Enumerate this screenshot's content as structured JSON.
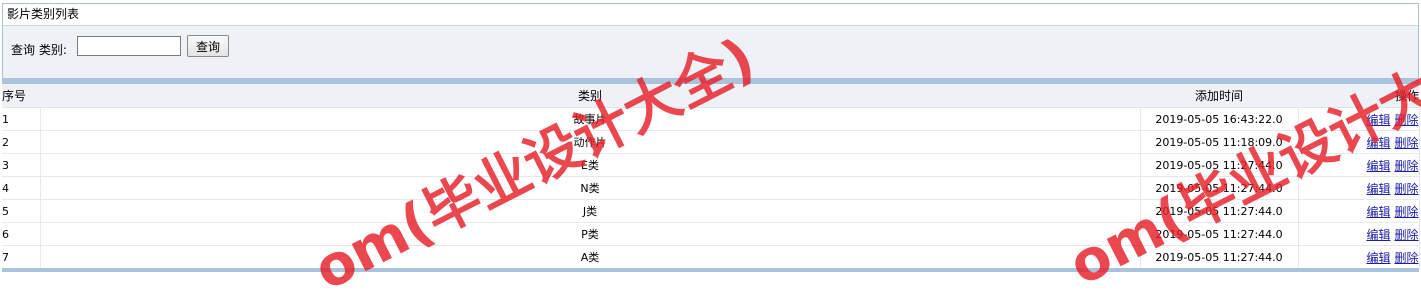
{
  "page": {
    "title": "影片类别列表"
  },
  "search": {
    "label": "查询 类别:",
    "value": "",
    "placeholder": "",
    "button_label": "查询"
  },
  "table": {
    "headers": {
      "seq": "序号",
      "type": "类别",
      "time": "添加时间",
      "ops": "操作"
    },
    "edit_label": "编辑",
    "delete_label": "删除",
    "rows": [
      {
        "seq": "1",
        "type": "故事片",
        "time": "2019-05-05 16:43:22.0"
      },
      {
        "seq": "2",
        "type": "动作片",
        "time": "2019-05-05 11:18:09.0"
      },
      {
        "seq": "3",
        "type": "E类",
        "time": "2019-05-05 11:27:44.0"
      },
      {
        "seq": "4",
        "type": "N类",
        "time": "2019-05-05 11:27:44.0"
      },
      {
        "seq": "5",
        "type": "J类",
        "time": "2019-05-05 11:27:44.0"
      },
      {
        "seq": "6",
        "type": "P类",
        "time": "2019-05-05 11:27:44.0"
      },
      {
        "seq": "7",
        "type": "A类",
        "time": "2019-05-05 11:27:44.0"
      }
    ]
  },
  "watermark": {
    "text": "om(毕业设计大全)",
    "text2": "om(毕业设计大"
  }
}
